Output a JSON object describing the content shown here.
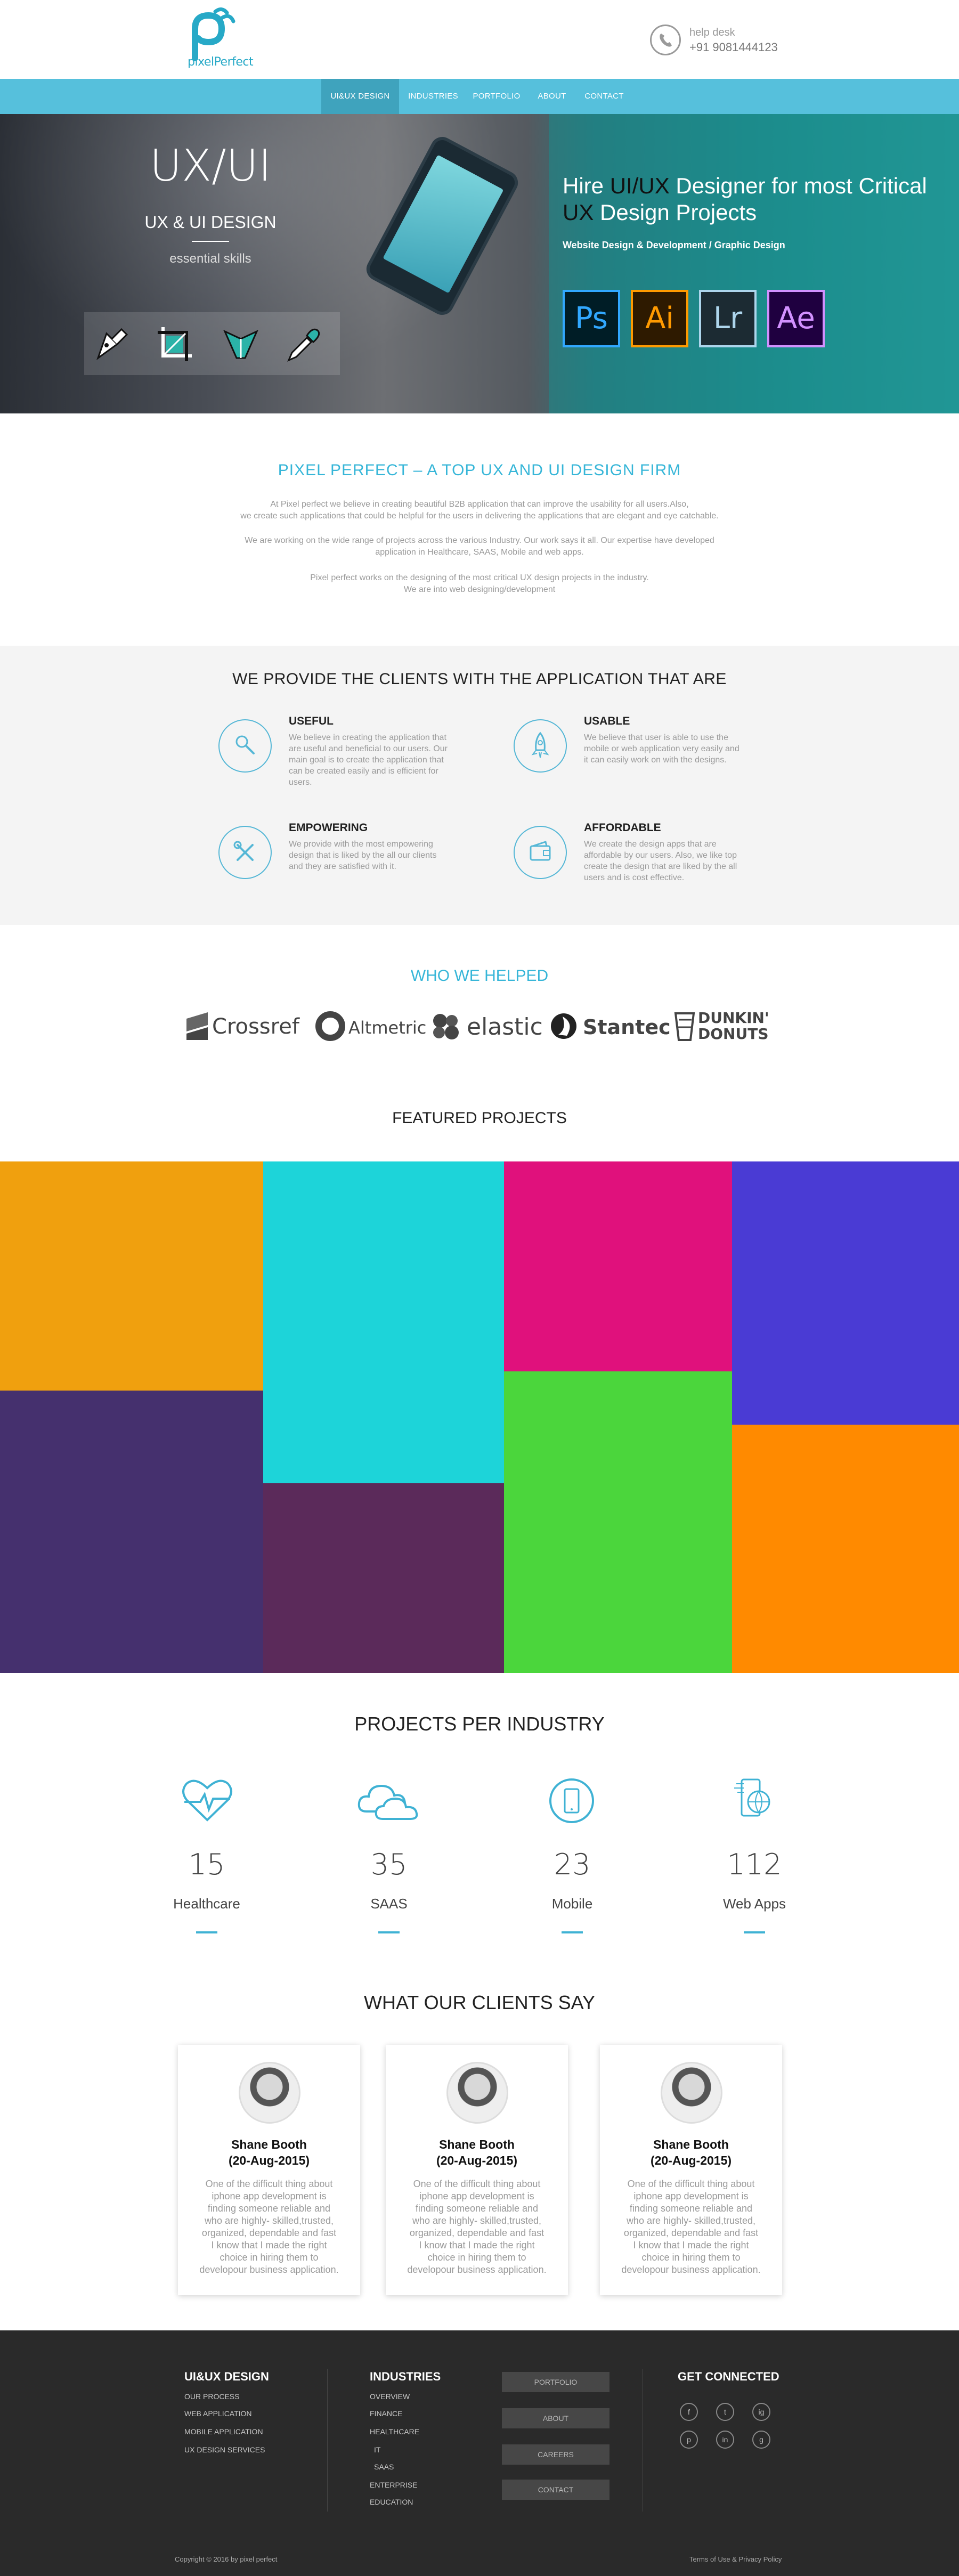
{
  "brand": {
    "logo_text": "pixelPerfect",
    "accent": "#37b6d8"
  },
  "header": {
    "helpdesk_label": "help desk",
    "helpdesk_phone": "+91 9081444123"
  },
  "nav": {
    "items": [
      "UI&UX DESIGN",
      "INDUSTRIES",
      "PORTFOLIO",
      "ABOUT",
      "CONTACT"
    ]
  },
  "hero": {
    "title": "UX/UI",
    "subtitle": "UX & UI DESIGN",
    "tagline": "essential skills",
    "headline_a": "Hire ",
    "headline_b": "UI/UX",
    "headline_c": " Designer for most Critical ",
    "headline_d": "UX",
    "headline_e": " Design Projects",
    "services": "Website Design & Development / Graphic Design",
    "apps": [
      "Ps",
      "Ai",
      "Lr",
      "Ae"
    ],
    "app_colors": [
      "#31a8ff",
      "#ff9a00",
      "#add5ec",
      "#d291ff"
    ],
    "tool_icons": [
      "pen-tool-icon",
      "crop-tool-icon",
      "vector-shape-icon",
      "eyedropper-icon"
    ]
  },
  "intro": {
    "title": "PIXEL PERFECT – A TOP UX AND UI DESIGN FIRM",
    "p1a": "At Pixel perfect we believe in creating beautiful B2B application that can improve the usability for all users.Also,",
    "p1b": "we create such applications that could be helpful for the users in delivering the applications that are elegant and eye catchable.",
    "p2a": "We are working on the wide range of projects across the various Industry. Our    work says it all. Our expertise have developed",
    "p2b": "application in Healthcare, SAAS, Mobile and web apps.",
    "p3a": "Pixel perfect works on the designing of the most critical UX design projects in the industry.",
    "p3b": "We are into web designing/development"
  },
  "provide": {
    "title": "WE PROVIDE THE CLIENTS WITH THE APPLICATION THAT ARE",
    "features": [
      {
        "title": "USEFUL",
        "text": "We believe in creating the application that are useful and beneficial to our users. Our main goal is to create the application that can be created easily and is efficient for users.",
        "icon": "magnifier-icon"
      },
      {
        "title": "USABLE",
        "text": "We believe that user is able to use the mobile or web application very easily and it can easily work on with the designs.",
        "icon": "rocket-icon"
      },
      {
        "title": "EMPOWERING",
        "text": "We provide with the most empowering design that is liked by the all our clients and they are satisfied with it.",
        "icon": "tools-icon"
      },
      {
        "title": "AFFORDABLE",
        "text": "We create the design apps that are affordable by our users. Also, we like top create the design that are liked by the all users and is cost effective.",
        "icon": "wallet-icon"
      }
    ]
  },
  "helped": {
    "title": "WHO WE HELPED",
    "logos": [
      "Crossref",
      "Altmetric",
      "elastic",
      "Stantec",
      "DUNKIN' DONUTS"
    ]
  },
  "featured": {
    "title": "FEATURED PROJECTS",
    "tile_colors": [
      "#f0a00e",
      "#1dd4d9",
      "#e0117c",
      "#4a3bd4",
      "#4a2e6e",
      "#51c9a5",
      "#4bd63c",
      "#ff8a00",
      "#5b2a5a"
    ]
  },
  "industry": {
    "title": "PROJECTS PER INDUSTRY",
    "stats": [
      {
        "value": "15",
        "label": "Healthcare",
        "icon": "heartbeat-icon"
      },
      {
        "value": "35",
        "label": "SAAS",
        "icon": "cloud-icon"
      },
      {
        "value": "23",
        "label": "Mobile",
        "icon": "mobile-icon"
      },
      {
        "value": "112",
        "label": "Web Apps",
        "icon": "web-app-icon"
      }
    ]
  },
  "testimonials": {
    "title": "WHAT OUR CLIENTS SAY",
    "items": [
      {
        "name": "Shane Booth",
        "date": "(20-Aug-2015)",
        "text": "One of the difficult thing about iphone app development is finding someone reliable and who are highly- skilled,trusted, organized, dependable and fast I know that I made the right choice in hiring them to developour business application."
      },
      {
        "name": "Shane Booth",
        "date": "(20-Aug-2015)",
        "text": "One of the difficult thing about iphone app development is finding someone reliable and who are highly- skilled,trusted, organized, dependable and fast I know that I made the right choice in hiring them to developour business application."
      },
      {
        "name": "Shane Booth",
        "date": "(20-Aug-2015)",
        "text": "One of the difficult thing about iphone app development is finding someone reliable and who are highly- skilled,trusted, organized, dependable and fast I know that I made the right choice in hiring them to developour business application."
      }
    ]
  },
  "footer": {
    "col1_title": "UI&UX DESIGN",
    "col1_links": [
      "OUR PROCESS",
      "WEB APPLICATION",
      "MOBILE APPLICATION",
      "UX DESIGN SERVICES"
    ],
    "col2_title": "INDUSTRIES",
    "col2_links": [
      "OVERVIEW",
      "FINANCE",
      "HEALTHCARE",
      "IT",
      "SAAS",
      "ENTERPRISE",
      "EDUCATION"
    ],
    "buttons": [
      "PORTFOLIO",
      "ABOUT",
      "CAREERS",
      "CONTACT"
    ],
    "connect_title": "GET CONNECTED",
    "social": [
      "f",
      "t",
      "ig",
      "p",
      "in",
      "g"
    ],
    "copyright": "Copyright © 2016 by pixel perfect",
    "terms": "Terms of Use & Privacy Policy"
  }
}
